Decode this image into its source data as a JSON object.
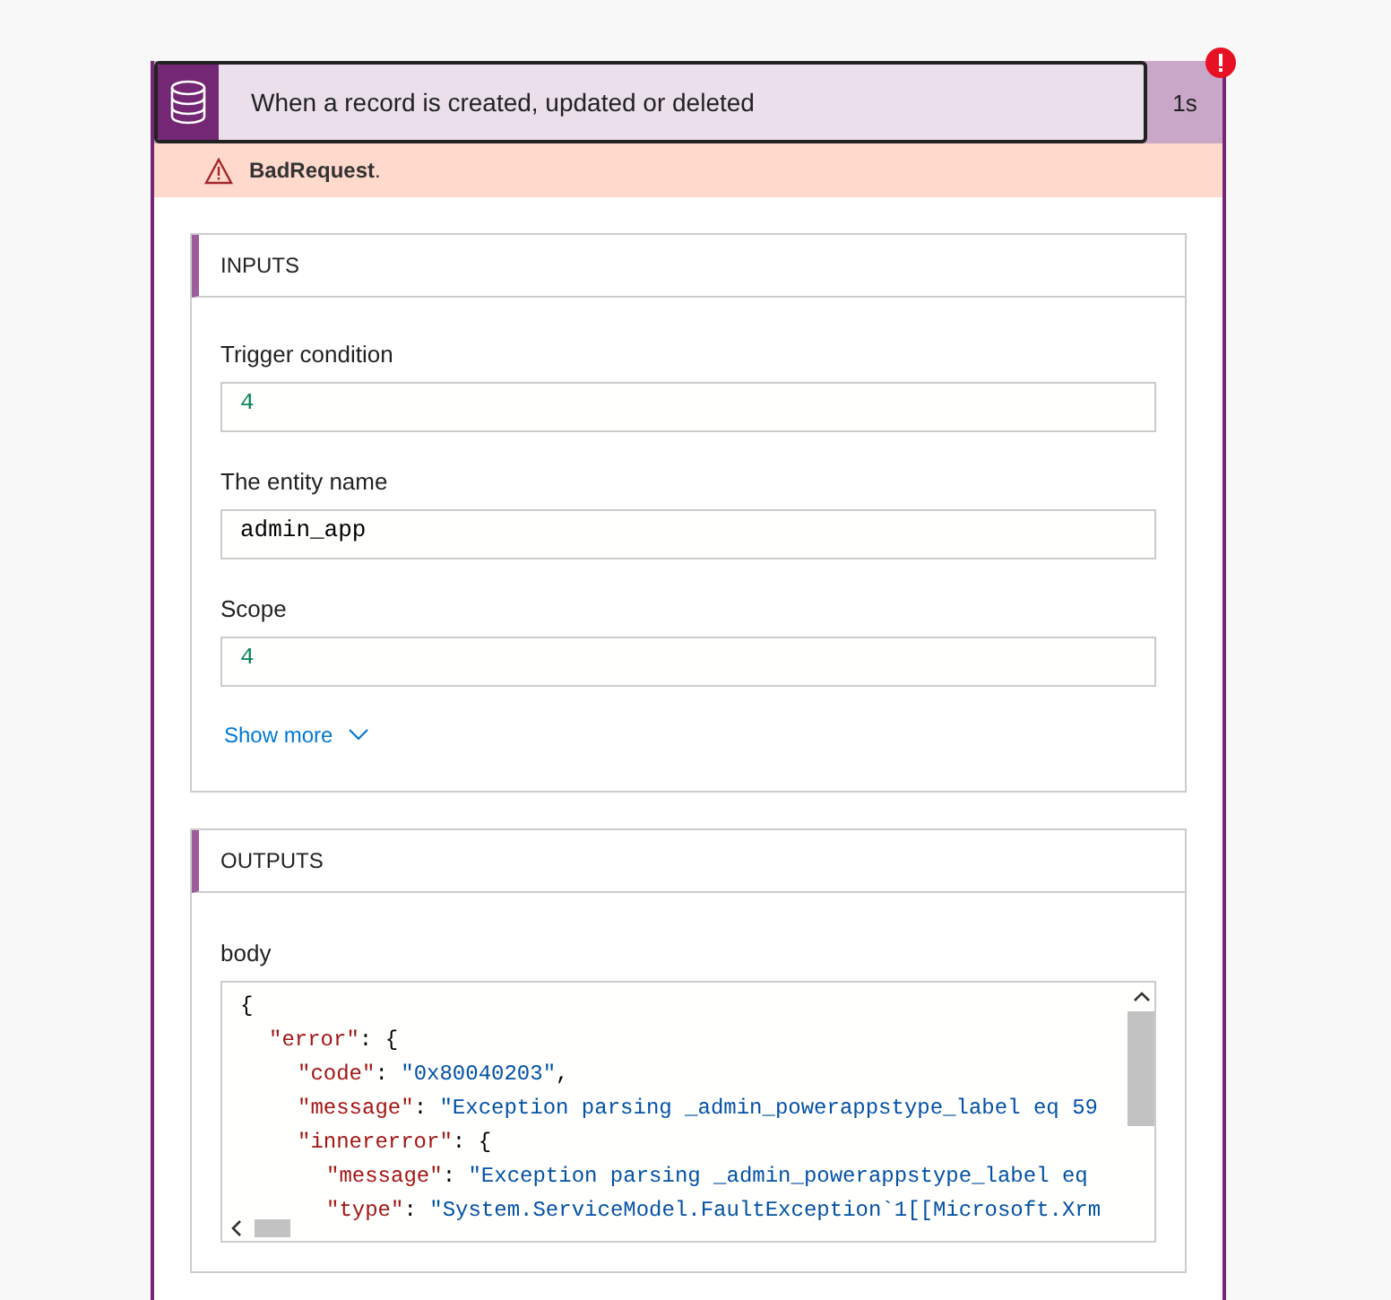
{
  "trigger": {
    "title": "When a record is created, updated or deleted",
    "duration": "1s",
    "failed": true
  },
  "error": {
    "code": "BadRequest",
    "suffix": "."
  },
  "inputs": {
    "heading": "INPUTS",
    "fields": [
      {
        "label": "Trigger condition",
        "value": "4",
        "kind": "number"
      },
      {
        "label": "The entity name",
        "value": "admin_app",
        "kind": "string"
      },
      {
        "label": "Scope",
        "value": "4",
        "kind": "number"
      }
    ],
    "show_more": "Show more"
  },
  "outputs": {
    "heading": "OUTPUTS",
    "body_label": "body",
    "code": [
      {
        "parts": [
          {
            "kind": "punct",
            "text": "{"
          }
        ],
        "children": [
          {
            "parts": [
              {
                "kind": "key",
                "text": "\"error\""
              },
              {
                "kind": "punct",
                "text": ": {"
              }
            ],
            "children": [
              {
                "parts": [
                  {
                    "kind": "key",
                    "text": "\"code\""
                  },
                  {
                    "kind": "punct",
                    "text": ": "
                  },
                  {
                    "kind": "string",
                    "text": "\"0x80040203\""
                  },
                  {
                    "kind": "punct",
                    "text": ","
                  }
                ]
              },
              {
                "parts": [
                  {
                    "kind": "key",
                    "text": "\"message\""
                  },
                  {
                    "kind": "punct",
                    "text": ": "
                  },
                  {
                    "kind": "string",
                    "text": "\"Exception parsing _admin_powerappstype_label eq 59"
                  }
                ]
              },
              {
                "parts": [
                  {
                    "kind": "key",
                    "text": "\"innererror\""
                  },
                  {
                    "kind": "punct",
                    "text": ": {"
                  }
                ],
                "children": [
                  {
                    "parts": [
                      {
                        "kind": "key",
                        "text": "\"message\""
                      },
                      {
                        "kind": "punct",
                        "text": ": "
                      },
                      {
                        "kind": "string",
                        "text": "\"Exception parsing _admin_powerappstype_label eq"
                      }
                    ]
                  },
                  {
                    "parts": [
                      {
                        "kind": "key",
                        "text": "\"type\""
                      },
                      {
                        "kind": "punct",
                        "text": ": "
                      },
                      {
                        "kind": "string",
                        "text": "\"System.ServiceModel.FaultException`1[[Microsoft.Xrm"
                      }
                    ]
                  }
                ]
              }
            ]
          }
        ]
      }
    ]
  }
}
